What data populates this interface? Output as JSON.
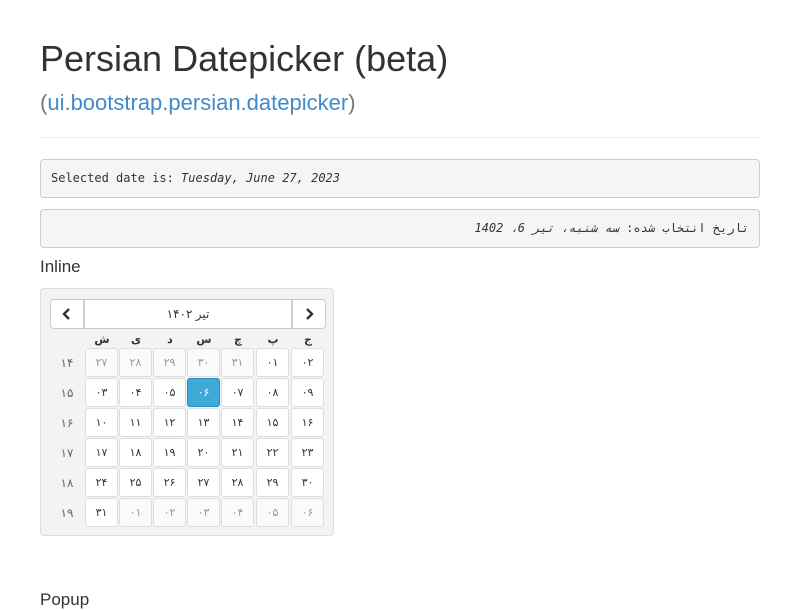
{
  "header": {
    "title": "Persian Datepicker (beta)",
    "subtitle_open": "(",
    "subtitle_link": "ui.bootstrap.persian.datepicker",
    "subtitle_close": ")"
  },
  "selected": {
    "label": "Selected date is: ",
    "value": "Tuesday, June 27, 2023",
    "persian_label": "تاریخ انتخاب شده: ",
    "persian_value": "سه شنبه، تیر 6، 1402"
  },
  "sections": {
    "inline": "Inline",
    "popup": "Popup"
  },
  "datepicker": {
    "prev_icon": "chevron-left-icon",
    "next_icon": "chevron-right-icon",
    "title": "تیر ۱۴۰۲",
    "weekdays": [
      "ش",
      "ی",
      "د",
      "س",
      "چ",
      "پ",
      "ج"
    ],
    "weeks": [
      {
        "num": "۱۴",
        "days": [
          {
            "t": "۲۷",
            "m": true
          },
          {
            "t": "۲۸",
            "m": true
          },
          {
            "t": "۲۹",
            "m": true
          },
          {
            "t": "۳۰",
            "m": true
          },
          {
            "t": "۳۱",
            "m": true
          },
          {
            "t": "۰۱",
            "m": false
          },
          {
            "t": "۰۲",
            "m": false
          }
        ]
      },
      {
        "num": "۱۵",
        "days": [
          {
            "t": "۰۳",
            "m": false
          },
          {
            "t": "۰۴",
            "m": false
          },
          {
            "t": "۰۵",
            "m": false
          },
          {
            "t": "۰۶",
            "m": false,
            "a": true
          },
          {
            "t": "۰۷",
            "m": false
          },
          {
            "t": "۰۸",
            "m": false
          },
          {
            "t": "۰۹",
            "m": false
          }
        ]
      },
      {
        "num": "۱۶",
        "days": [
          {
            "t": "۱۰",
            "m": false
          },
          {
            "t": "۱۱",
            "m": false
          },
          {
            "t": "۱۲",
            "m": false
          },
          {
            "t": "۱۳",
            "m": false
          },
          {
            "t": "۱۴",
            "m": false
          },
          {
            "t": "۱۵",
            "m": false
          },
          {
            "t": "۱۶",
            "m": false
          }
        ]
      },
      {
        "num": "۱۷",
        "days": [
          {
            "t": "۱۷",
            "m": false
          },
          {
            "t": "۱۸",
            "m": false
          },
          {
            "t": "۱۹",
            "m": false
          },
          {
            "t": "۲۰",
            "m": false
          },
          {
            "t": "۲۱",
            "m": false
          },
          {
            "t": "۲۲",
            "m": false
          },
          {
            "t": "۲۳",
            "m": false
          }
        ]
      },
      {
        "num": "۱۸",
        "days": [
          {
            "t": "۲۴",
            "m": false
          },
          {
            "t": "۲۵",
            "m": false
          },
          {
            "t": "۲۶",
            "m": false
          },
          {
            "t": "۲۷",
            "m": false
          },
          {
            "t": "۲۸",
            "m": false
          },
          {
            "t": "۲۹",
            "m": false
          },
          {
            "t": "۳۰",
            "m": false
          }
        ]
      },
      {
        "num": "۱۹",
        "days": [
          {
            "t": "۳۱",
            "m": false
          },
          {
            "t": "۰۱",
            "m": true
          },
          {
            "t": "۰۲",
            "m": true
          },
          {
            "t": "۰۳",
            "m": true
          },
          {
            "t": "۰۴",
            "m": true
          },
          {
            "t": "۰۵",
            "m": true
          },
          {
            "t": "۰۶",
            "m": true
          }
        ]
      }
    ]
  },
  "colors": {
    "link": "#428bca",
    "active_day": "#3eaad8"
  }
}
